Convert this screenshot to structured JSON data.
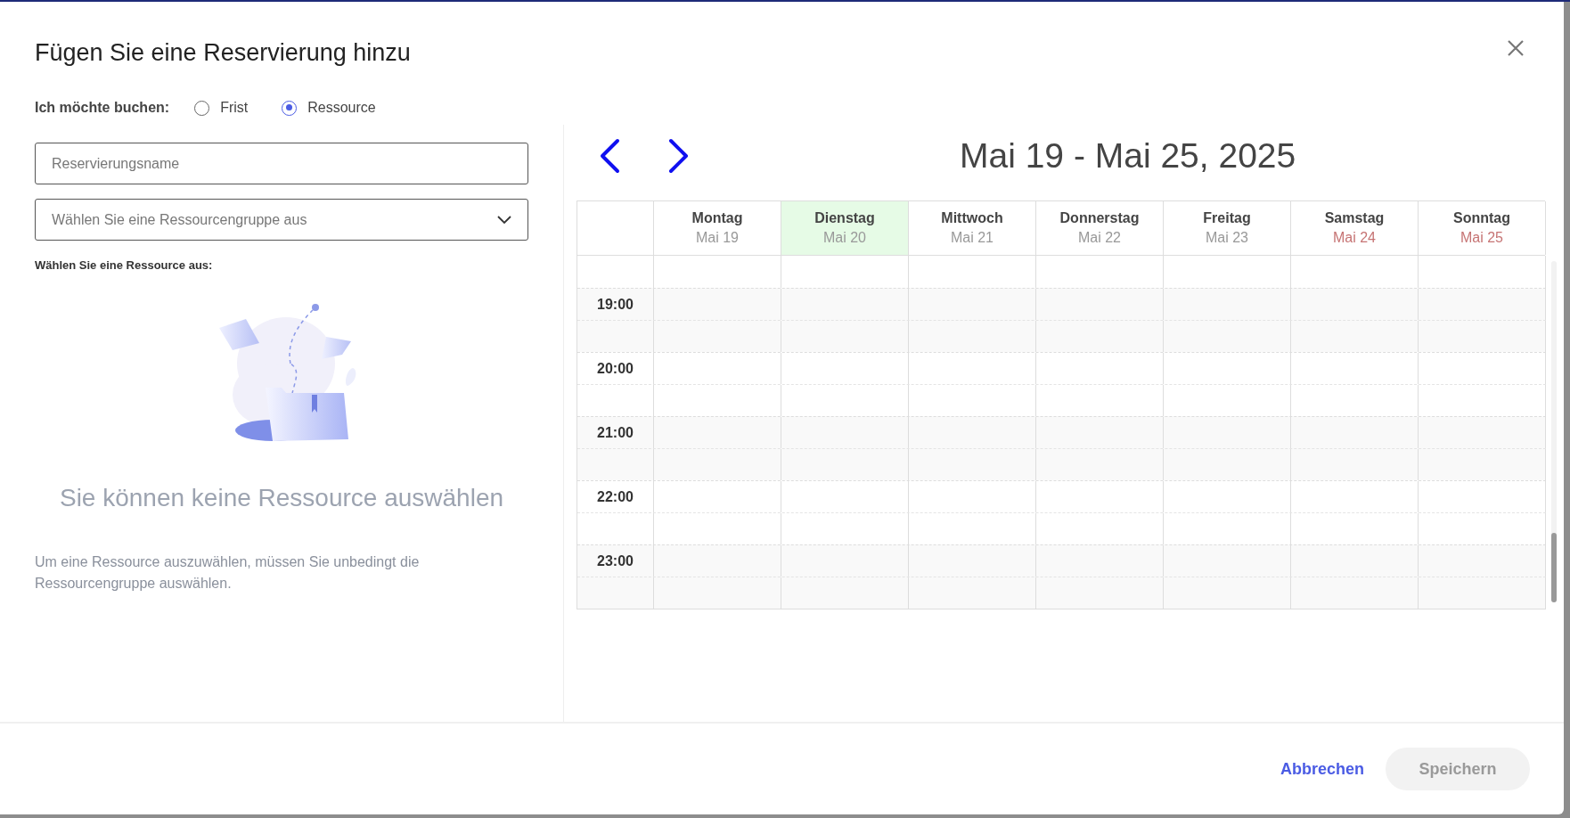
{
  "dialog": {
    "title": "Fügen Sie eine Reservierung hinzu"
  },
  "booking_type": {
    "label": "Ich möchte buchen:",
    "options": [
      {
        "label": "Frist",
        "selected": false
      },
      {
        "label": "Ressource",
        "selected": true
      }
    ]
  },
  "name_field": {
    "placeholder": "Reservierungsname"
  },
  "group_select": {
    "placeholder": "Wählen Sie eine Ressourcengruppe aus"
  },
  "resource_label": "Wählen Sie eine Ressource aus:",
  "empty_state": {
    "title": "Sie können keine Ressource auswählen",
    "description": "Um eine Ressource auszuwählen, müssen Sie unbedingt die Ressourcengruppe auswählen."
  },
  "calendar": {
    "range_title": "Mai 19 - Mai 25, 2025",
    "days": [
      {
        "name": "Montag",
        "date": "Mai 19",
        "today": false,
        "weekend": false
      },
      {
        "name": "Dienstag",
        "date": "Mai 20",
        "today": true,
        "weekend": false
      },
      {
        "name": "Mittwoch",
        "date": "Mai 21",
        "today": false,
        "weekend": false
      },
      {
        "name": "Donnerstag",
        "date": "Mai 22",
        "today": false,
        "weekend": false
      },
      {
        "name": "Freitag",
        "date": "Mai 23",
        "today": false,
        "weekend": false
      },
      {
        "name": "Samstag",
        "date": "Mai 24",
        "today": false,
        "weekend": true
      },
      {
        "name": "Sonntag",
        "date": "Mai 25",
        "today": false,
        "weekend": true
      }
    ],
    "hours": [
      "19:00",
      "20:00",
      "21:00",
      "22:00",
      "23:00"
    ]
  },
  "footer": {
    "buttons": [
      {
        "label": "Abbrechen",
        "kind": "link",
        "disabled": false
      },
      {
        "label": "Speichern",
        "kind": "filled",
        "disabled": true
      }
    ]
  }
}
